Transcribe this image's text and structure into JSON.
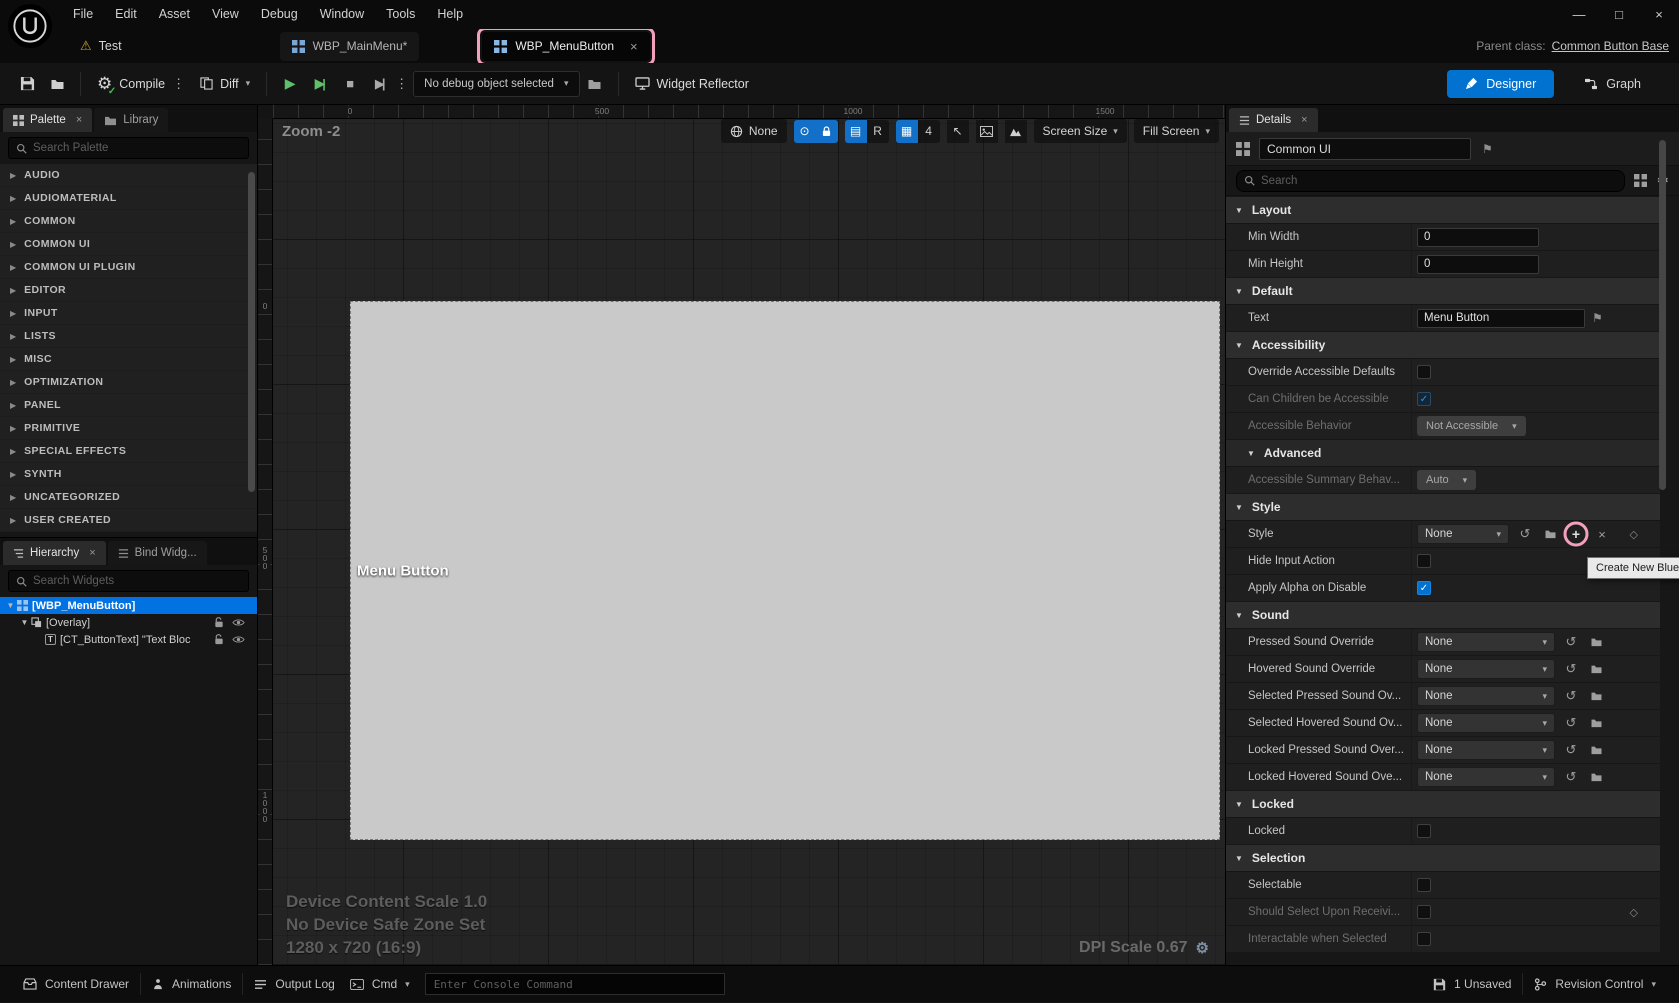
{
  "colors": {
    "accent": "#0272d0",
    "highlight_pink": "#f2a0bc",
    "selection_blue": "#0271e2",
    "widget_canvas_gray": "#c9c9c9",
    "compile_green": "#3fbf4a"
  },
  "titlebar": {
    "menu": [
      "File",
      "Edit",
      "Asset",
      "View",
      "Debug",
      "Window",
      "Tools",
      "Help"
    ]
  },
  "tabbar": {
    "asset_name": "Test",
    "tabs": [
      {
        "label": "WBP_MainMenu*"
      },
      {
        "label": "WBP_MenuButton"
      }
    ],
    "parent_class_label": "Parent class:",
    "parent_class_value": "Common Button Base"
  },
  "toolbar": {
    "compile_label": "Compile",
    "diff_label": "Diff",
    "debug_select_label": "No debug object selected",
    "widget_reflector_label": "Widget Reflector",
    "designer_label": "Designer",
    "graph_label": "Graph"
  },
  "palette": {
    "tab_palette": "Palette",
    "tab_library": "Library",
    "search_placeholder": "Search Palette",
    "categories": [
      "AUDIO",
      "AUDIOMATERIAL",
      "COMMON",
      "COMMON UI",
      "COMMON UI PLUGIN",
      "EDITOR",
      "INPUT",
      "LISTS",
      "MISC",
      "OPTIMIZATION",
      "PANEL",
      "PRIMITIVE",
      "SPECIAL EFFECTS",
      "SYNTH",
      "UNCATEGORIZED",
      "USER CREATED"
    ]
  },
  "hierarchy": {
    "tab_hierarchy": "Hierarchy",
    "tab_bind": "Bind Widg...",
    "search_placeholder": "Search Widgets",
    "items": [
      {
        "label": "[WBP_MenuButton]",
        "depth": 0,
        "selected": true,
        "expander": "▼",
        "icon": "widget",
        "lock": false
      },
      {
        "label": "[Overlay]",
        "depth": 1,
        "selected": false,
        "expander": "▼",
        "icon": "overlay",
        "lock": true
      },
      {
        "label": "[CT_ButtonText] \"Text Bloc",
        "depth": 2,
        "selected": false,
        "expander": "",
        "icon": "text",
        "lock": true
      }
    ]
  },
  "canvas": {
    "zoom_label": "Zoom -2",
    "ruler_h": [
      "0",
      "500",
      "1000",
      "1500"
    ],
    "ruler_v": [
      "0",
      "500",
      "1000"
    ],
    "toolbar": {
      "none_label": "None",
      "r_label": "R",
      "grid_snap": "4",
      "screen_size_label": "Screen Size",
      "fill_screen_label": "Fill Screen"
    },
    "widget_text": "Menu Button",
    "overlay_lines": [
      "Device Content Scale 1.0",
      "No Device Safe Zone Set",
      "1280 x 720 (16:9)"
    ],
    "dpi_label": "DPI Scale 0.67"
  },
  "details": {
    "tab_label": "Details",
    "object_name": "Common UI",
    "search_placeholder": "Search",
    "tooltip": "Create New Blue",
    "rows": [
      {
        "kind": "section",
        "label": "Layout"
      },
      {
        "kind": "input",
        "label": "Min Width",
        "value": "0"
      },
      {
        "kind": "input",
        "label": "Min Height",
        "value": "0"
      },
      {
        "kind": "section",
        "label": "Default"
      },
      {
        "kind": "textinput",
        "label": "Text",
        "value": "Menu Button",
        "flag": true
      },
      {
        "kind": "section",
        "label": "Accessibility"
      },
      {
        "kind": "checkbox",
        "label": "Override Accessible Defaults",
        "checked": false
      },
      {
        "kind": "checkbox",
        "label": "Can Children be Accessible",
        "checked": true,
        "dim": true
      },
      {
        "kind": "graydrop",
        "label": "Accessible Behavior",
        "value": "Not Accessible",
        "dim": true
      },
      {
        "kind": "section",
        "label": "Advanced",
        "sub": true
      },
      {
        "kind": "graydrop",
        "label": "Accessible Summary Behav...",
        "value": "Auto",
        "dim": true
      },
      {
        "kind": "section",
        "label": "Style"
      },
      {
        "kind": "style",
        "label": "Style",
        "value": "None"
      },
      {
        "kind": "checkbox",
        "label": "Hide Input Action",
        "checked": false
      },
      {
        "kind": "checkbox",
        "label": "Apply Alpha on Disable",
        "checked": true
      },
      {
        "kind": "section",
        "label": "Sound"
      },
      {
        "kind": "sound",
        "label": "Pressed Sound Override",
        "value": "None"
      },
      {
        "kind": "sound",
        "label": "Hovered Sound Override",
        "value": "None"
      },
      {
        "kind": "sound",
        "label": "Selected Pressed Sound Ov...",
        "value": "None"
      },
      {
        "kind": "sound",
        "label": "Selected Hovered Sound Ov...",
        "value": "None"
      },
      {
        "kind": "sound",
        "label": "Locked Pressed Sound Over...",
        "value": "None"
      },
      {
        "kind": "sound",
        "label": "Locked Hovered Sound Ove...",
        "value": "None"
      },
      {
        "kind": "section",
        "label": "Locked"
      },
      {
        "kind": "checkbox",
        "label": "Locked",
        "checked": false
      },
      {
        "kind": "section",
        "label": "Selection"
      },
      {
        "kind": "checkbox",
        "label": "Selectable",
        "checked": false
      },
      {
        "kind": "checkbox",
        "label": "Should Select Upon Receivi...",
        "checked": false,
        "dim": true,
        "diamond": true
      },
      {
        "kind": "checkbox",
        "label": "Interactable when Selected",
        "checked": false,
        "dim": true
      }
    ]
  },
  "statusbar": {
    "content_drawer": "Content Drawer",
    "animations": "Animations",
    "output_log": "Output Log",
    "cmd": "Cmd",
    "console_placeholder": "Enter Console Command",
    "unsaved": "1 Unsaved",
    "revision_control": "Revision Control"
  }
}
